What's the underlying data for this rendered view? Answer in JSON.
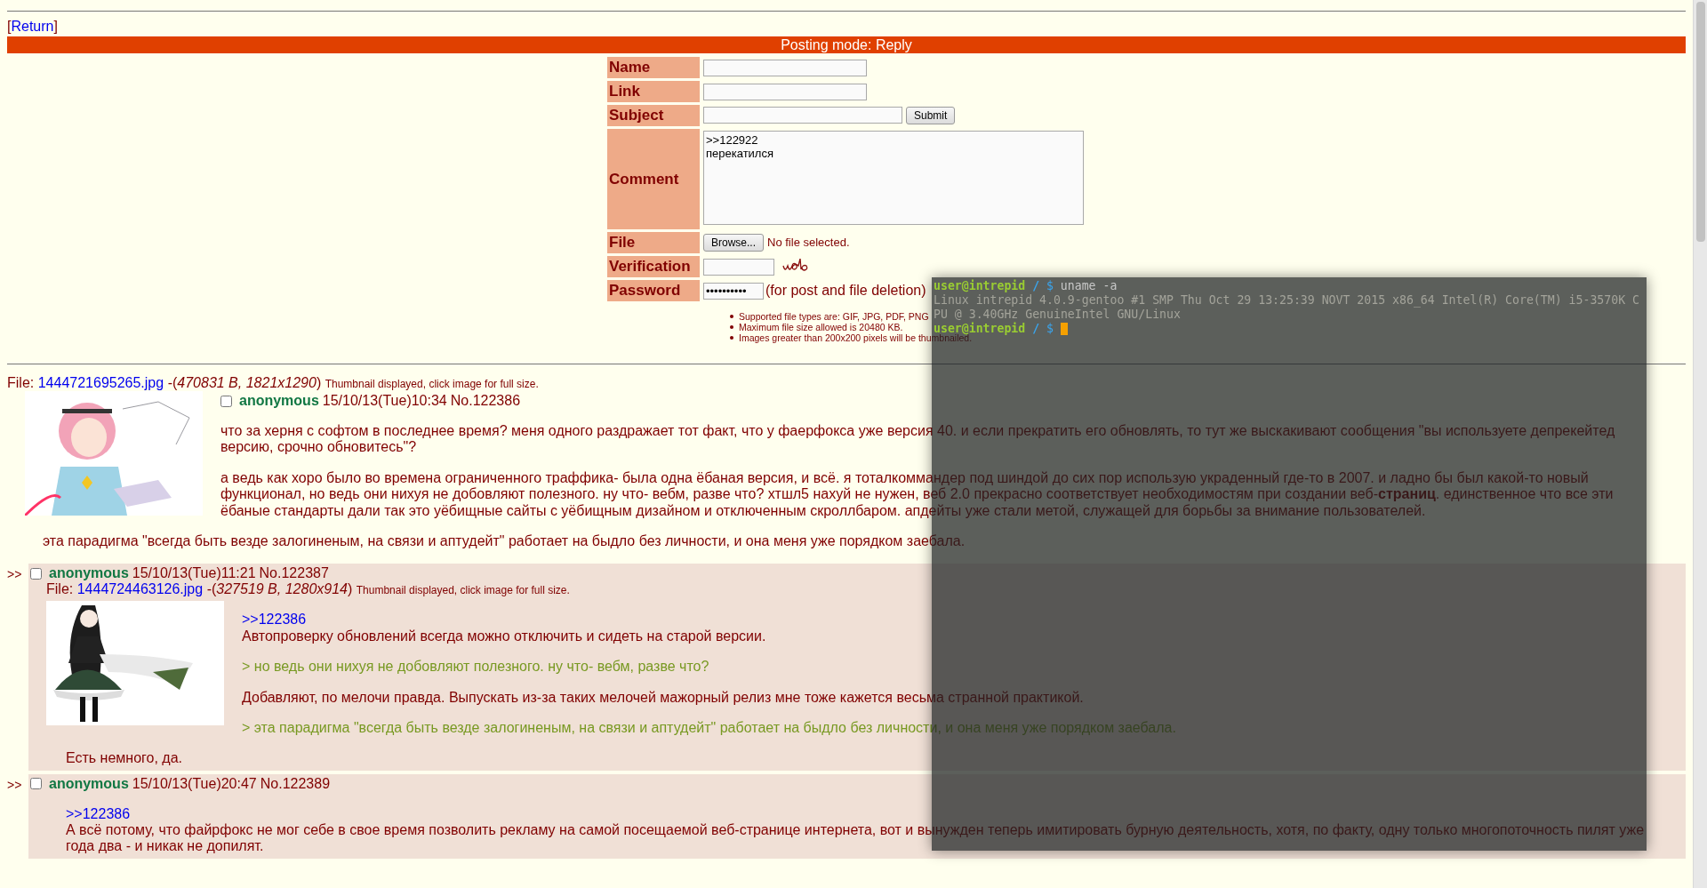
{
  "return_link": {
    "open": "[",
    "label": "Return",
    "close": "]"
  },
  "posting_bar": "Posting mode: Reply",
  "form": {
    "rows": [
      {
        "label": "Name",
        "kind": "text"
      },
      {
        "label": "Link",
        "kind": "text"
      },
      {
        "label": "Subject",
        "kind": "text",
        "button": "Submit"
      },
      {
        "label": "Comment",
        "kind": "textarea",
        "value": ">>122922\nперекатился"
      },
      {
        "label": "File",
        "kind": "file",
        "button": "Browse...",
        "status": "No file selected."
      },
      {
        "label": "Verification",
        "kind": "captcha"
      },
      {
        "label": "Password",
        "kind": "password",
        "value": "••••••••••",
        "note": "(for post and file deletion)"
      }
    ],
    "rules": [
      "Supported file types are: GIF, JPG, PDF, PNG",
      "Maximum file size allowed is 20480 KB.",
      "Images greater than 200x200 pixels will be thumbnailed."
    ]
  },
  "posts": [
    {
      "kind": "op",
      "file": {
        "label": "File:",
        "filename": "1444721695265.jpg",
        "details": "-(*470831 B, 1821x1290*)",
        "note": "Thumbnail displayed, click image for full size."
      },
      "thumbnail": {
        "kind": "picture"
      },
      "checked": false,
      "name": "anonymous",
      "date": "15/10/13(Tue)10:34",
      "number": "No.122386",
      "paragraphs": [
        [
          {
            "kind": "text",
            "text": "что за херня с софтом в последнее время? меня одного раздражает тот факт, что у фаерфокса уже версия 40. и если прекратить его обновлять, то тут же выскакивают сообщения \"вы используете депрекейтед версию, срочно обновитесь\"?"
          }
        ],
        [
          {
            "kind": "text",
            "text": "а ведь как хоро было во времена ограниченного траффика- была одна ёбаная версия, и всё. я тоталкоммандер под шиндой до сих пор использую украденный где-то в 2007. и ладно бы был какой-то новый функционал, но ведь они нихуя не добовляют полезного. ну что- вебм, разве что? хтшл5 нахуй не нужен, веб 2.0 прекрасно соответствует необходимостям при создании веб-**страниц**. единственное что все эти ёбаные стандарты дали так это уёбищные сайты с уёбищным дизайном и отключенным скроллбаром. апдейты уже стали метой, служащей для борьбы за внимание пользователей."
          }
        ],
        [
          {
            "kind": "text",
            "text": "эта парадигма \"всегда быть везде залогиненым, на связи и аптудейт\" работает на быдло без личности, и она меня уже порядком заебала."
          }
        ]
      ]
    },
    {
      "kind": "reply",
      "marker": ">>",
      "checked": false,
      "name": "anonymous",
      "date": "15/10/13(Tue)11:21",
      "number": "No.122387",
      "file": {
        "label": "File:",
        "filename": "1444724463126.jpg",
        "details": "-(*327519 B, 1280x914*)",
        "note": "Thumbnail displayed, click image for full size."
      },
      "thumbnail": {
        "kind": "picture"
      },
      "paragraphs": [
        [
          {
            "kind": "link",
            "text": ">>122386"
          },
          {
            "kind": "text",
            "text": "Автопроверку обновлений всегда можно отключить и сидеть на старой версии."
          }
        ],
        [
          {
            "kind": "quote",
            "text": "> но ведь они нихуя не добовляют полезного. ну что- вебм, разве что?"
          }
        ],
        [
          {
            "kind": "text",
            "text": "Добавляют, по мелочи правда. Выпускать из-за таких мелочей мажорный релиз мне тоже кажется весьма странной практикой."
          }
        ],
        [
          {
            "kind": "quote",
            "text": "> эта парадигма \"всегда быть везде залогиненым, на связи и аптудейт\" работает на быдло без личности, и она меня уже порядком заебала."
          }
        ],
        [
          {
            "kind": "text",
            "text": "Есть немного, да."
          }
        ]
      ]
    },
    {
      "kind": "reply",
      "marker": ">>",
      "checked": false,
      "name": "anonymous",
      "date": "15/10/13(Tue)20:47",
      "number": "No.122389",
      "paragraphs": [
        [
          {
            "kind": "link",
            "text": ">>122386"
          },
          {
            "kind": "text",
            "text": "А всё потому, что файрфокс не мог себе в свое время позволить рекламу на самой посещаемой веб-странице интернета, вот и вынужден теперь имитировать бурную деятельность, хотя, по факту, одну только многопоточность пилят уже года два - и никак не допилят."
          }
        ]
      ]
    }
  ],
  "terminal": {
    "lines": [
      {
        "kind": "prompt",
        "user": "user@intrepid",
        "path": "/",
        "symbol": "$",
        "command": "uname -a"
      },
      {
        "kind": "output",
        "text": "Linux intrepid 4.0.9-gentoo #1 SMP Thu Oct 29 13:25:39 NOVT 2015 x86_64 Intel(R) Core(TM) i5-3570K C"
      },
      {
        "kind": "output",
        "text": "PU @ 3.40GHz GenuineIntel GNU/Linux"
      },
      {
        "kind": "prompt",
        "user": "user@intrepid",
        "path": "/",
        "symbol": "$",
        "cursor": true
      }
    ]
  }
}
